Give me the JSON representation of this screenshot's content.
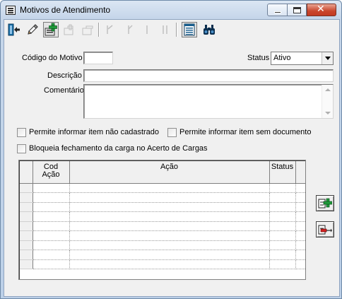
{
  "window": {
    "title": "Motivos de Atendimento"
  },
  "toolbar": {
    "buttons": [
      {
        "icon": "exit-icon",
        "enabled": true
      },
      {
        "icon": "pencil-edit-icon",
        "enabled": true
      },
      {
        "icon": "new-record-icon",
        "enabled": true
      },
      {
        "icon": "save-icon",
        "enabled": false
      },
      {
        "icon": "cancel-icon",
        "enabled": false
      },
      {
        "icon": "first-record-icon",
        "enabled": false
      },
      {
        "icon": "previous-record-icon",
        "enabled": false
      },
      {
        "icon": "next-record-icon",
        "enabled": false
      },
      {
        "icon": "last-record-icon",
        "enabled": false
      },
      {
        "icon": "list-view-icon",
        "enabled": true
      },
      {
        "icon": "binoculars-search-icon",
        "enabled": true
      }
    ]
  },
  "form": {
    "codigo_label": "Código do Motivo",
    "codigo_value": "",
    "status_label": "Status",
    "status_value": "Ativo",
    "descricao_label": "Descrição",
    "descricao_value": "",
    "comentario_label": "Comentário",
    "comentario_value": "",
    "checkbox_item_nao_cadastrado": {
      "label": "Permite informar item não cadastrado",
      "checked": false
    },
    "checkbox_item_sem_documento": {
      "label": "Permite informar item sem documento",
      "checked": false
    },
    "checkbox_bloqueia_fechamento": {
      "label": "Bloqueia fechamento da carga no Acerto de Cargas",
      "checked": false
    }
  },
  "grid": {
    "columns": {
      "cod_line1": "Cod",
      "cod_line2": "Ação",
      "acao": "Ação",
      "status": "Status"
    },
    "rows": [
      {
        "cod": "",
        "acao": "",
        "status": ""
      },
      {
        "cod": "",
        "acao": "",
        "status": ""
      },
      {
        "cod": "",
        "acao": "",
        "status": ""
      },
      {
        "cod": "",
        "acao": "",
        "status": ""
      },
      {
        "cod": "",
        "acao": "",
        "status": ""
      },
      {
        "cod": "",
        "acao": "",
        "status": ""
      },
      {
        "cod": "",
        "acao": "",
        "status": ""
      },
      {
        "cod": "",
        "acao": "",
        "status": ""
      },
      {
        "cod": "",
        "acao": "",
        "status": ""
      }
    ]
  },
  "side_buttons": [
    {
      "icon": "add-row-icon"
    },
    {
      "icon": "remove-row-icon"
    }
  ]
}
